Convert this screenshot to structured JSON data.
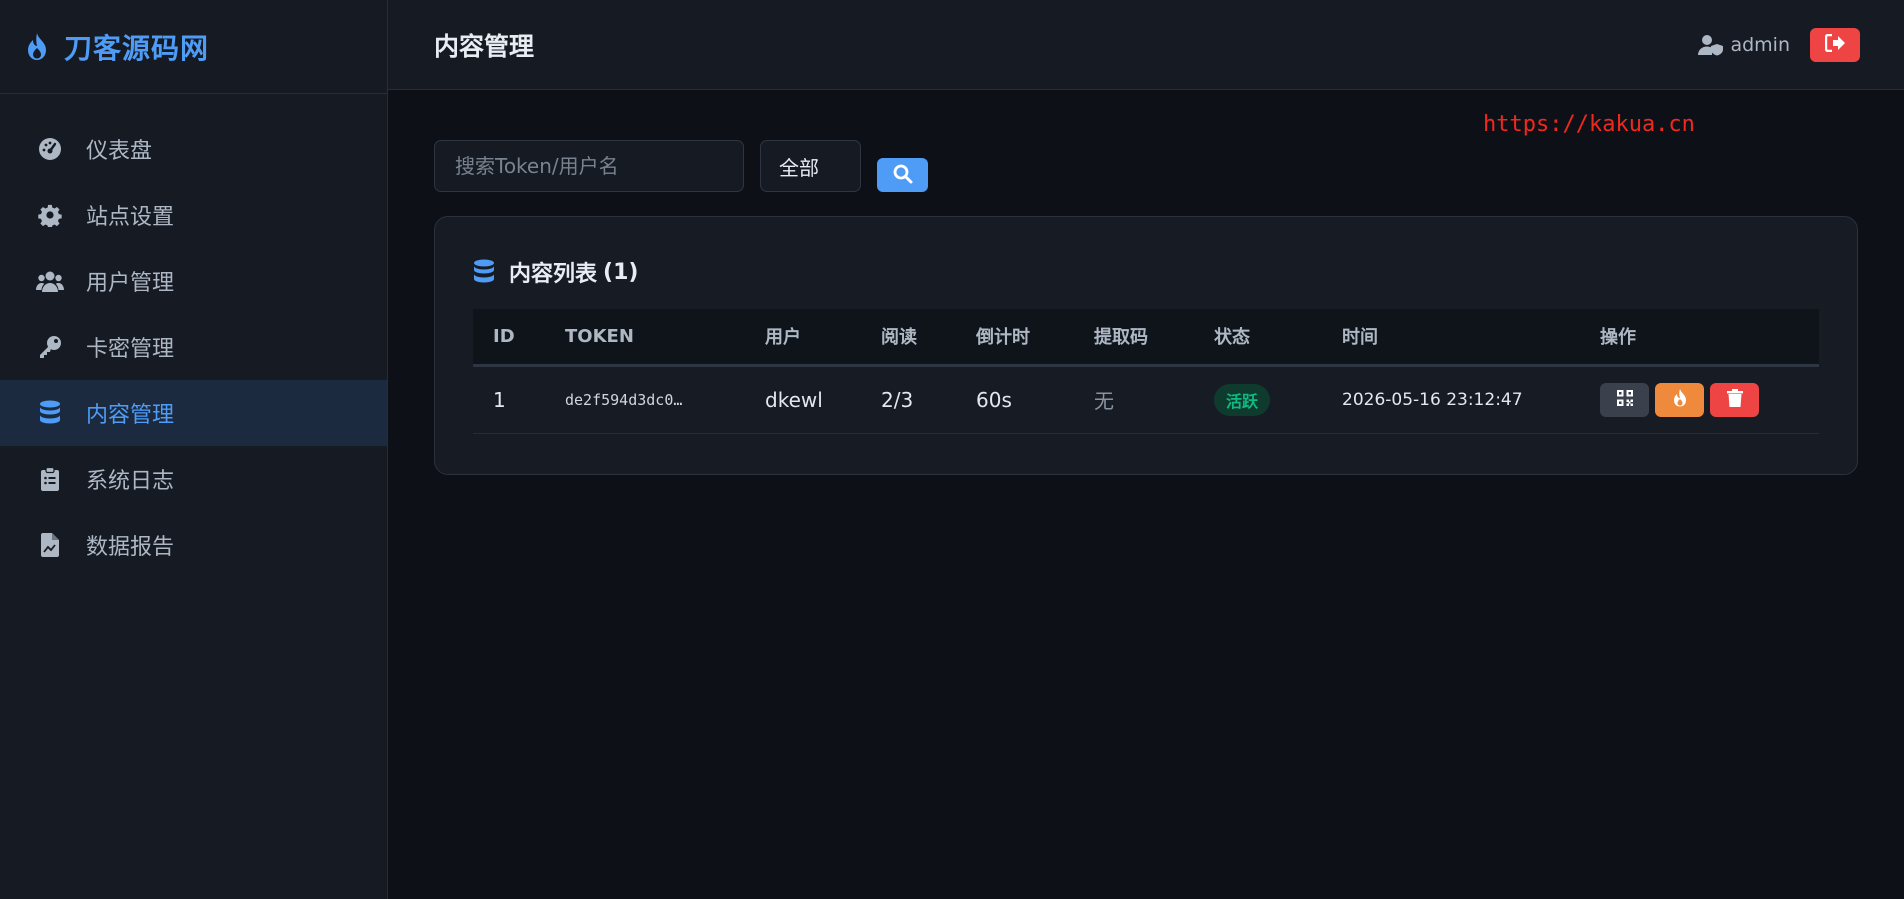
{
  "brand": {
    "name": "刀客源码网",
    "color": "#4f9cf7"
  },
  "sidebar": {
    "items": [
      {
        "label": "仪表盘",
        "icon": "gauge-icon",
        "active": false
      },
      {
        "label": "站点设置",
        "icon": "gear-icon",
        "active": false
      },
      {
        "label": "用户管理",
        "icon": "users-icon",
        "active": false
      },
      {
        "label": "卡密管理",
        "icon": "key-icon",
        "active": false
      },
      {
        "label": "内容管理",
        "icon": "database-icon",
        "active": true
      },
      {
        "label": "系统日志",
        "icon": "clipboard-icon",
        "active": false
      },
      {
        "label": "数据报告",
        "icon": "file-chart-icon",
        "active": false
      }
    ]
  },
  "header": {
    "title": "内容管理",
    "user": "admin",
    "logout_icon": "sign-out-icon"
  },
  "watermark": "https://kakua.cn",
  "filters": {
    "search_placeholder": "搜索Token/用户名",
    "status_selected": "全部",
    "search_icon": "search-icon"
  },
  "card": {
    "title": "内容列表",
    "count": "(1)",
    "icon": "database-icon"
  },
  "table": {
    "columns": [
      "ID",
      "TOKEN",
      "用户",
      "阅读",
      "倒计时",
      "提取码",
      "状态",
      "时间",
      "操作"
    ],
    "rows": [
      {
        "id": "1",
        "token": "de2f594d3dc0…",
        "user": "dkewl",
        "reads": "2/3",
        "countdown": "60s",
        "code": "无",
        "status": "活跃",
        "time": "2026-05-16 23:12:47"
      }
    ]
  },
  "colors": {
    "accent": "#4f9cf7",
    "danger": "#ef4444",
    "warning": "#ef8a3c",
    "success": "#10b981",
    "watermark": "#f0281e"
  }
}
